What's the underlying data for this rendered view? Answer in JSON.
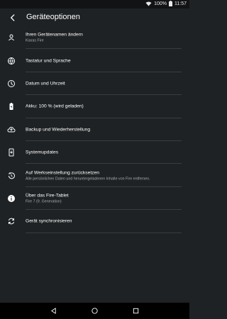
{
  "status_bar": {
    "battery_percent": "100%",
    "time": "11:57",
    "icons": [
      "wifi-icon",
      "battery-icon"
    ]
  },
  "app_bar": {
    "title": "Geräteoptionen",
    "back_icon": "back-arrow-icon"
  },
  "settings": [
    {
      "label": "Ihren Gerätenamen ändern",
      "sub": "Kiaras Fire",
      "icon": "person-icon"
    },
    {
      "label": "Tastatur und Sprache",
      "icon": "globe-icon"
    },
    {
      "label": "Datum und Uhrzeit",
      "icon": "clock-icon"
    },
    {
      "label": "Akku: 100 % (wird geladen)",
      "icon": "battery-icon"
    },
    {
      "label": "Backup und Wiederherstellung",
      "icon": "cloud-icon"
    },
    {
      "label": "Systemupdates",
      "icon": "system-update-icon"
    },
    {
      "label": "Auf Werkseinstellung zurücksetzen",
      "sub": "Alle persönlichen Daten und heruntergeladenen Inhalte von Fire entfernen.",
      "icon": "reset-history-icon"
    },
    {
      "label": "Über das Fire-Tablet",
      "sub": "Fire 7 (9. Generation)",
      "icon": "info-icon"
    },
    {
      "label": "Gerät synchronisieren",
      "icon": "sync-icon"
    }
  ],
  "nav_bar": {
    "icons": [
      "back-triangle-icon",
      "home-circle-icon",
      "recents-square-icon"
    ]
  },
  "colors": {
    "background": "#1f2224",
    "divider": "#3a3d3f",
    "subtext": "#a9acae",
    "navbar": "#000000"
  }
}
